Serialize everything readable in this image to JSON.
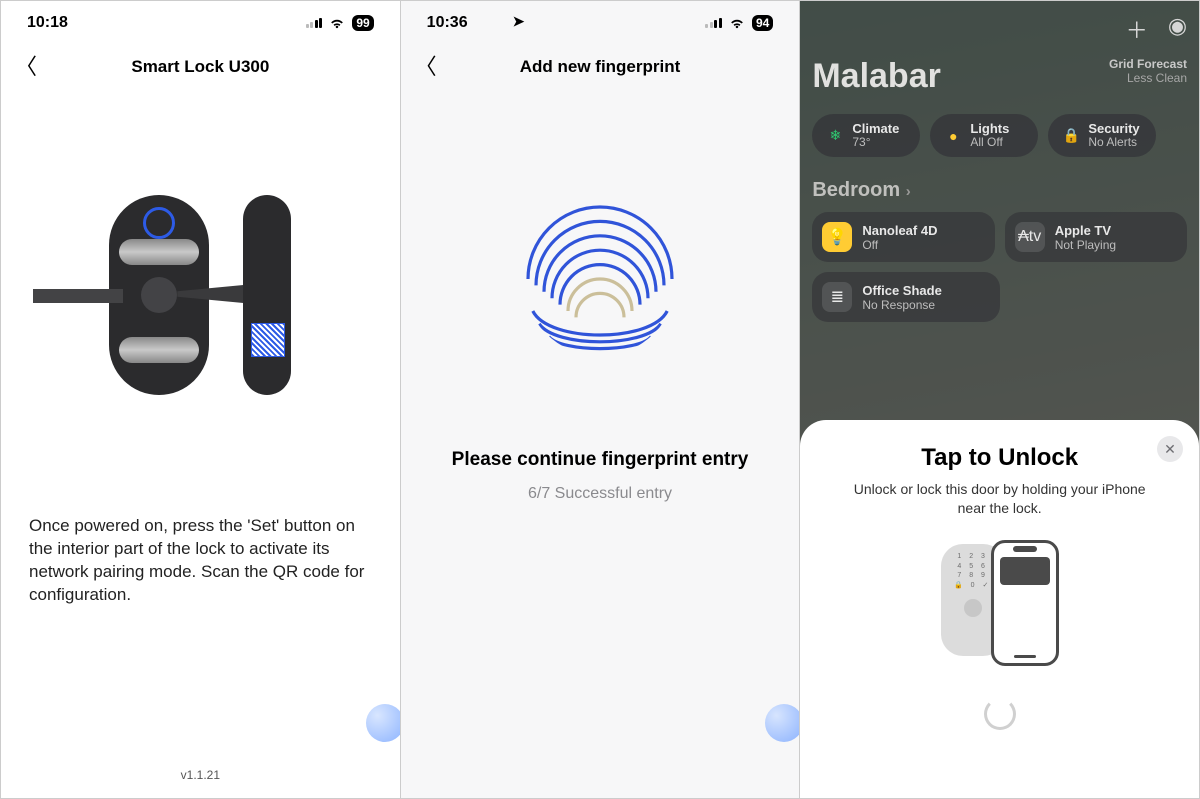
{
  "s1": {
    "time": "10:18",
    "battery": "99",
    "title": "Smart Lock U300",
    "instructions": "Once powered on, press the 'Set' button on the interior part of the lock to activate its network pairing mode. Scan the QR code for configuration.",
    "version": "v1.1.21"
  },
  "s2": {
    "time": "10:36",
    "battery": "94",
    "title": "Add new fingerprint",
    "message": "Please continue fingerprint entry",
    "progress": "6/7 Successful entry"
  },
  "s3": {
    "home_name": "Malabar",
    "grid_forecast_label": "Grid Forecast",
    "grid_forecast_value": "Less Clean",
    "status_pills": [
      {
        "icon": "❄︎",
        "icon_color": "#2fc971",
        "label": "Climate",
        "sub": "73°"
      },
      {
        "icon": "●",
        "icon_color": "#ffcc33",
        "label": "Lights",
        "sub": "All Off"
      },
      {
        "icon": "🔒",
        "icon_color": "#3b82f6",
        "label": "Security",
        "sub": "No Alerts"
      }
    ],
    "section": "Bedroom",
    "tiles": [
      {
        "icon": "💡",
        "icon_bg": "#ffcc33",
        "name": "Nanoleaf 4D",
        "sub": "Off"
      },
      {
        "icon": "₳tv",
        "icon_bg": "rgba(255,255,255,.12)",
        "name": "Apple TV",
        "sub": "Not Playing"
      },
      {
        "icon": "≣",
        "icon_bg": "rgba(255,255,255,.12)",
        "name": "Office Shade",
        "sub": "No Response"
      }
    ],
    "sheet": {
      "title": "Tap to Unlock",
      "subtitle": "Unlock or lock this door by holding your iPhone near the lock.",
      "keypad_rows": [
        "1 2 3",
        "4 5 6",
        "7 8 9",
        "🔒 0 ✓"
      ]
    }
  }
}
